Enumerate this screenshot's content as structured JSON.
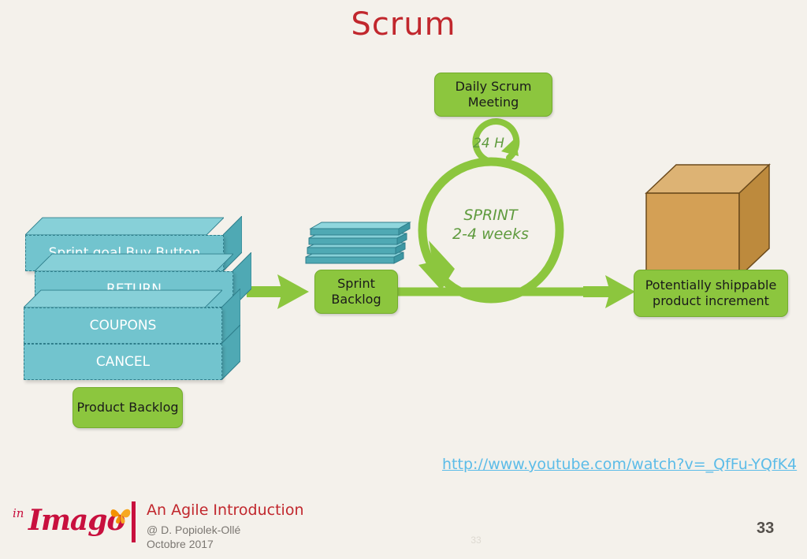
{
  "slide": {
    "title": "Scrum",
    "background_color": "#f4f1eb",
    "accent_green": "#8cc63e",
    "accent_teal": "#72c4ce",
    "accent_red": "#c1272d",
    "accent_brown": "#d4a055",
    "link_color": "#5cbce8"
  },
  "product_backlog": {
    "caption": "Product Backlog",
    "items": [
      {
        "label": "Sprint goal Buy Button"
      },
      {
        "label": "RETURN"
      },
      {
        "label": "COUPONS"
      },
      {
        "label": "CANCEL"
      }
    ]
  },
  "sprint_backlog": {
    "caption": "Sprint Backlog",
    "sheet_count": 4
  },
  "daily_scrum": {
    "caption": "Daily Scrum Meeting",
    "cycle_label": "24 H"
  },
  "sprint": {
    "label_line1": "SPRINT",
    "label_line2": "2-4 weeks"
  },
  "increment": {
    "caption": "Potentially shippable product increment"
  },
  "link": {
    "text": "http://www.youtube.com/watch?v=_QfFu-YQfK4"
  },
  "footer": {
    "logo_prefix": "in",
    "logo_name": "Imago",
    "title": "An Agile Introduction",
    "author": "@ D. Popiolek-Ollé",
    "date": "Octobre 2017",
    "page_number": "33",
    "page_number_faint": "33"
  }
}
